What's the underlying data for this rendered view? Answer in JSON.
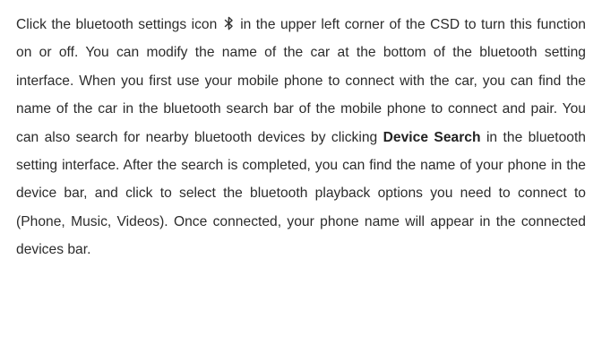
{
  "paragraph": {
    "seg1": "Click the bluetooth settings icon ",
    "icon": "bluetooth-icon",
    "seg2": " in the upper left corner of the CSD to turn this function on or off. You can modify the name of the car at the bottom of the bluetooth setting interface. When you first use your mobile phone to connect with the car, you can find the name of the car in the bluetooth search bar of the mobile phone to connect and pair. You can also search for nearby bluetooth devices by clicking ",
    "bold_term": "Device Search",
    "seg3": " in the bluetooth setting interface. After the search is completed, you can find the name of your phone in the device bar, and click to select the bluetooth playback options you need to connect to (Phone, Music, Videos). Once connected, your phone name will appear in the connected devices bar."
  }
}
